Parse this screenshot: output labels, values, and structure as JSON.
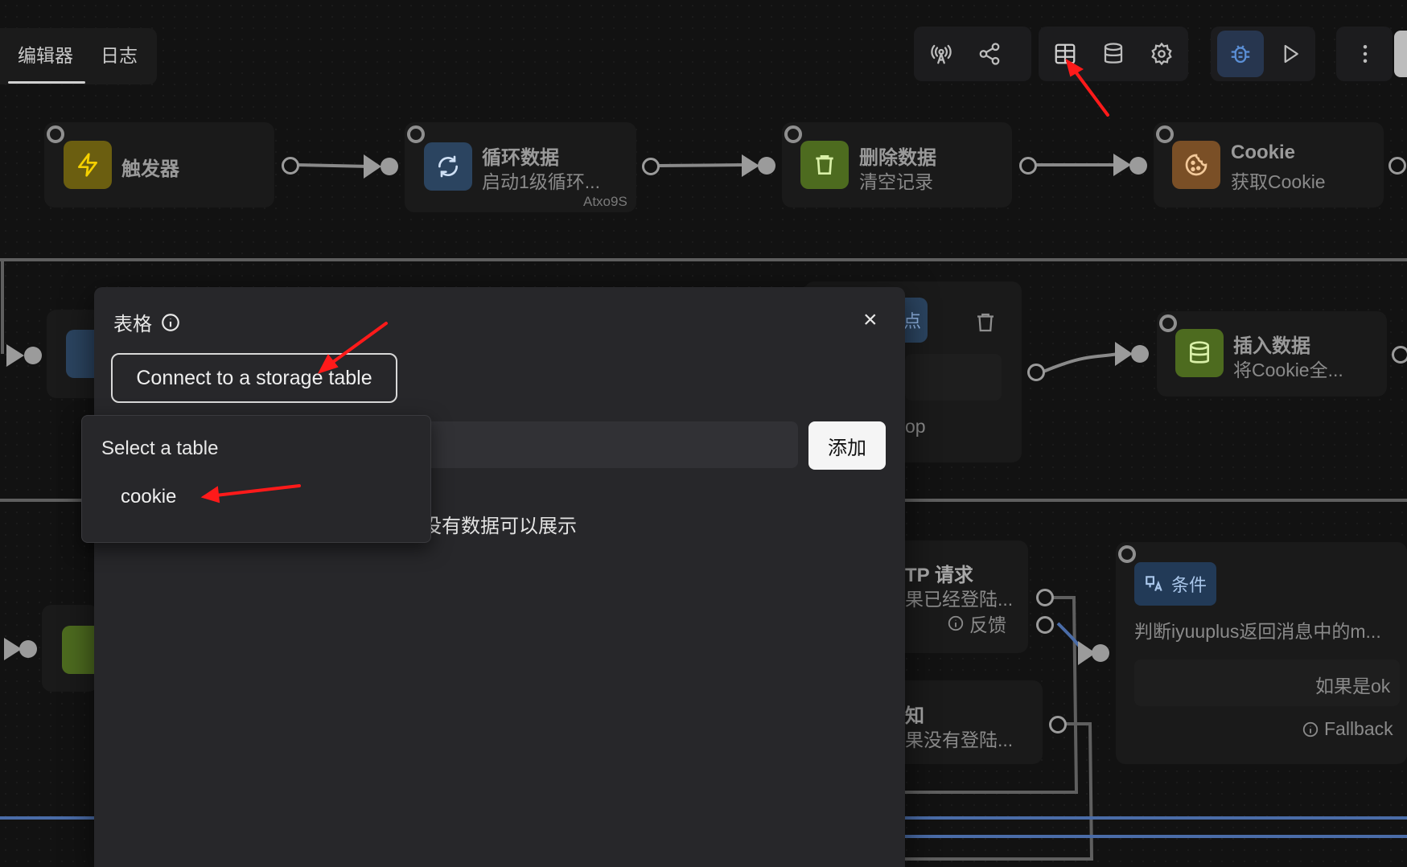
{
  "tabs": [
    {
      "label": "编辑器",
      "active": true
    },
    {
      "label": "日志",
      "active": false
    }
  ],
  "toolbar": {
    "icons": [
      "broadcast-icon",
      "share-icon",
      "table-icon",
      "database-icon",
      "settings-icon",
      "debug-icon",
      "play-icon",
      "more-icon"
    ]
  },
  "nodes": {
    "trigger": {
      "title": "触发器",
      "color": "#e3c200"
    },
    "loop": {
      "title": "循环数据",
      "subtitle": "启动1级循环...",
      "id_label": "Atxo9S",
      "color": "#5b8fd6"
    },
    "delete": {
      "title": "删除数据",
      "subtitle": "清空记录",
      "color": "#8fbf3f"
    },
    "cookie": {
      "title": "Cookie",
      "subtitle": "获取Cookie",
      "color": "#e0924a"
    },
    "insert": {
      "title": "插入数据",
      "subtitle": "将Cookie全...",
      "color": "#8fbf3f"
    },
    "http_partial": {
      "title": "TP 请求",
      "subtitle": "果已经登陆...",
      "feedback": "反馈"
    },
    "notify_partial": {
      "title": "知",
      "subtitle": "果没有登陆..."
    },
    "loop_partial": {
      "label": "op"
    },
    "node_partial_label": "点",
    "condition": {
      "badge": "条件",
      "description": "判断iyuuplus返回消息中的m...",
      "branch": "如果是ok",
      "fallback": "Fallback"
    }
  },
  "dialog": {
    "title": "表格",
    "connect_button": "Connect to a storage table",
    "add_button": "添加",
    "empty_text": "没有数据可以展示",
    "close_label": "×"
  },
  "dropdown": {
    "label": "Select a table",
    "options": [
      "cookie"
    ]
  },
  "colors": {
    "annotation_arrow": "#ff1a1a",
    "accent_debug": "#27364f"
  }
}
